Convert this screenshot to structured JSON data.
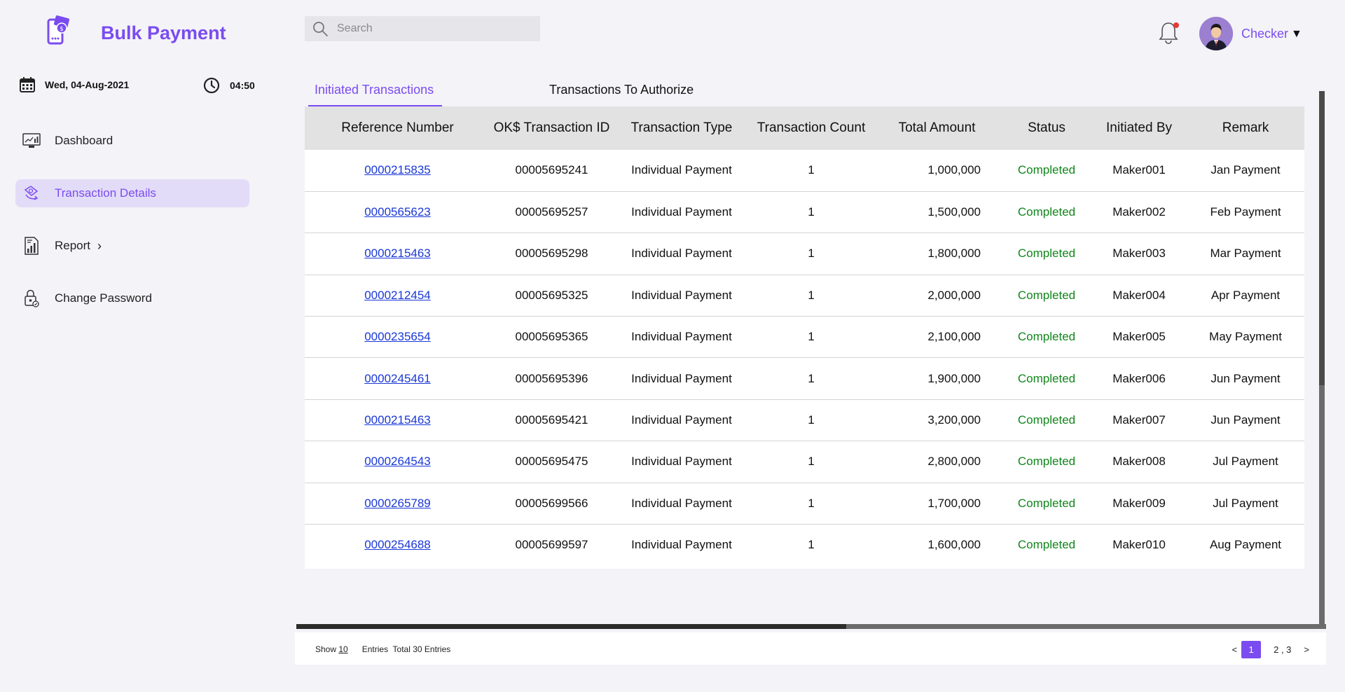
{
  "brand": {
    "title": "Bulk Payment",
    "logo_icon": "mobile-payment-icon"
  },
  "datetime": {
    "date": "Wed, 04-Aug-2021",
    "time": "04:50"
  },
  "sidebar": {
    "items": [
      {
        "label": "Dashboard",
        "icon": "dashboard-icon",
        "active": false
      },
      {
        "label": "Transaction Details",
        "icon": "transaction-icon",
        "active": true
      },
      {
        "label": "Report",
        "icon": "report-icon",
        "active": false,
        "chevron": "›"
      },
      {
        "label": "Change Password",
        "icon": "lock-icon",
        "active": false
      }
    ]
  },
  "header": {
    "search_placeholder": "Search",
    "user": {
      "name": "Checker",
      "caret": "▼"
    }
  },
  "tabs": [
    {
      "label": "Initiated Transactions",
      "active": true
    },
    {
      "label": "Transactions To Authorize",
      "active": false
    }
  ],
  "table": {
    "columns": [
      "Reference Number",
      "OK$ Transaction ID",
      "Transaction Type",
      "Transaction Count",
      "Total Amount",
      "Status",
      "Initiated By",
      "Remark"
    ],
    "rows": [
      [
        "0000215835",
        "00005695241",
        "Individual Payment",
        "1",
        "1,000,000",
        "Completed",
        "Maker001",
        "Jan Payment"
      ],
      [
        "0000565623",
        "00005695257",
        "Individual Payment",
        "1",
        "1,500,000",
        "Completed",
        "Maker002",
        "Feb Payment"
      ],
      [
        "0000215463",
        "00005695298",
        "Individual Payment",
        "1",
        "1,800,000",
        "Completed",
        "Maker003",
        "Mar Payment"
      ],
      [
        "0000212454",
        "00005695325",
        "Individual Payment",
        "1",
        "2,000,000",
        "Completed",
        "Maker004",
        "Apr Payment"
      ],
      [
        "0000235654",
        "00005695365",
        "Individual Payment",
        "1",
        "2,100,000",
        "Completed",
        "Maker005",
        "May Payment"
      ],
      [
        "0000245461",
        "00005695396",
        "Individual Payment",
        "1",
        "1,900,000",
        "Completed",
        "Maker006",
        "Jun Payment"
      ],
      [
        "0000215463",
        "00005695421",
        "Individual Payment",
        "1",
        "3,200,000",
        "Completed",
        "Maker007",
        "Jun Payment"
      ],
      [
        "0000264543",
        "00005695475",
        "Individual Payment",
        "1",
        "2,800,000",
        "Completed",
        "Maker008",
        "Jul Payment"
      ],
      [
        "0000265789",
        "00005699566",
        "Individual Payment",
        "1",
        "1,700,000",
        "Completed",
        "Maker009",
        "Jul Payment"
      ],
      [
        "0000254688",
        "00005699597",
        "Individual Payment",
        "1",
        "1,600,000",
        "Completed",
        "Maker010",
        "Aug Payment"
      ]
    ]
  },
  "footer": {
    "show_label": "Show",
    "show_value": "10",
    "entries_label": "Entries",
    "total_label": "Total 30 Entries",
    "pager": {
      "prev": "<",
      "current": "1",
      "rest": "2 , 3",
      "next": ">"
    }
  },
  "colors": {
    "accent": "#7a4cf0",
    "status_completed": "#10861a",
    "link": "#1a38d6"
  }
}
